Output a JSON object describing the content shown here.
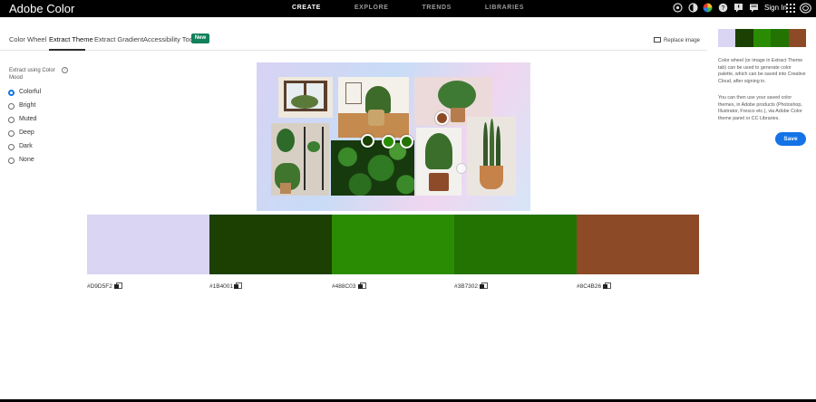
{
  "app": {
    "title": "Adobe Color"
  },
  "topnav": [
    {
      "label": "CREATE",
      "active": true
    },
    {
      "label": "EXPLORE",
      "active": false
    },
    {
      "label": "TRENDS",
      "active": false
    },
    {
      "label": "LIBRARIES",
      "active": false
    }
  ],
  "topbar": {
    "icons": [
      "gear-badge-icon",
      "contrast-icon",
      "color-wheel-icon",
      "help-icon",
      "alert-icon",
      "chat-icon"
    ],
    "sign_in": "Sign In",
    "apps_icon": "apps-grid-icon",
    "logo_icon": "adobe-cc-icon"
  },
  "tabs": [
    {
      "label": "Color Wheel",
      "active": false
    },
    {
      "label": "Extract Theme",
      "active": true
    },
    {
      "label": "Extract Gradient",
      "active": false
    },
    {
      "label": "Accessibility Tools",
      "active": false
    }
  ],
  "new_badge": "New",
  "replace_image": "Replace image",
  "mood": {
    "title": "Extract using Color Mood",
    "options": [
      "Colorful",
      "Bright",
      "Muted",
      "Deep",
      "Dark",
      "None"
    ],
    "selected": "Colorful"
  },
  "sidebar": {
    "text1": "Color wheel (or image in Extract Theme tab) can be used to generate color palette, which can be saved into Creative Cloud, after signing in.",
    "text2": "You can then use your saved color themes, in Adobe products (Photoshop, Illustrator, Fresco etc.), via Adobe Color theme panel or CC Libraries.",
    "save_label": "Save"
  },
  "palette": [
    {
      "hex": "#D9D5F2",
      "color": "#D9D5F2"
    },
    {
      "hex": "#1B4001",
      "color": "#1B4001"
    },
    {
      "hex": "#488C03",
      "color": "#2A8C03"
    },
    {
      "hex": "#3B7302",
      "color": "#237302"
    },
    {
      "hex": "#8C4B26",
      "color": "#8C4B26"
    }
  ]
}
